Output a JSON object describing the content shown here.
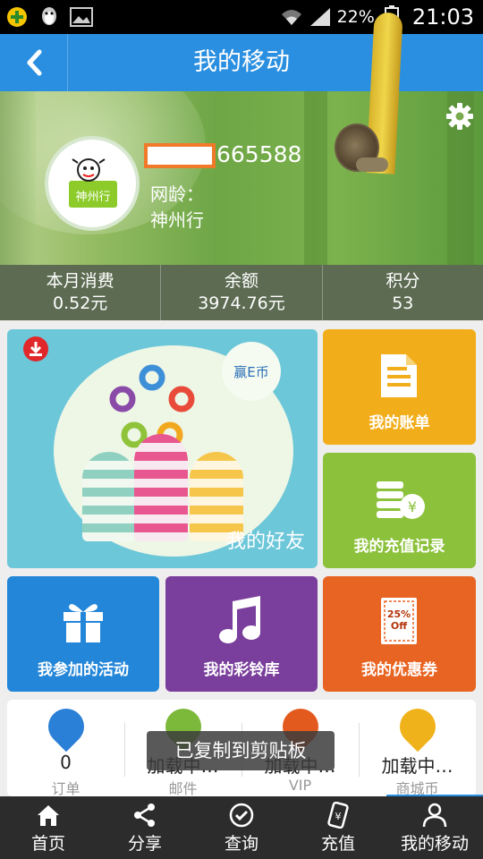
{
  "status_bar": {
    "battery": "22%",
    "time": "21:03"
  },
  "header": {
    "title": "我的移动"
  },
  "profile": {
    "phone_suffix": "665588",
    "net_age_label": "网龄：",
    "brand": "神州行",
    "logo_text": "神州行"
  },
  "stats": [
    {
      "label": "本月消费",
      "value": "0.52元"
    },
    {
      "label": "余额",
      "value": "3974.76元"
    },
    {
      "label": "积分",
      "value": "53"
    }
  ],
  "tiles": {
    "friends": "我的好友",
    "ecoin": "赢E币",
    "bill": "我的账单",
    "recharge": "我的充值记录",
    "activity": "我参加的活动",
    "ringtone": "我的彩铃库",
    "coupon": "我的优惠券",
    "coupon_badge": "25% Off"
  },
  "info": [
    {
      "value": "0",
      "caption": "订单",
      "color": "#2a7fd6"
    },
    {
      "value": "加载中…",
      "caption": "邮件",
      "color": "#7cb83a"
    },
    {
      "value": "加载中…",
      "caption": "VIP",
      "color": "#e25a1e"
    },
    {
      "value": "加载中…",
      "caption": "商城币",
      "color": "#f0b21a"
    }
  ],
  "toast": "已复制到剪贴板",
  "nav": [
    {
      "label": "首页",
      "icon": "home-icon"
    },
    {
      "label": "分享",
      "icon": "share-icon"
    },
    {
      "label": "查询",
      "icon": "check-icon"
    },
    {
      "label": "充值",
      "icon": "recharge-phone-icon"
    },
    {
      "label": "我的移动",
      "icon": "person-icon"
    }
  ]
}
